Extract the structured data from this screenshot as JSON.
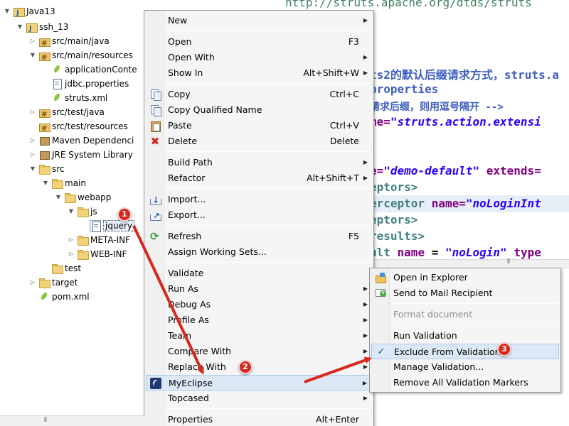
{
  "tree": {
    "items": [
      {
        "label": "Java13",
        "icon": "project-icon",
        "toggle": "▼"
      },
      {
        "label": "ssh_13",
        "icon": "maven-project-icon",
        "toggle": "▼"
      },
      {
        "label": "src/main/java",
        "icon": "source-folder-icon",
        "toggle": "▷"
      },
      {
        "label": "src/main/resources",
        "icon": "source-folder-icon",
        "toggle": "▼"
      },
      {
        "label": "applicationConte",
        "icon": "spring-leaf-icon",
        "toggle": ""
      },
      {
        "label": "jdbc.properties",
        "icon": "properties-file-icon",
        "toggle": ""
      },
      {
        "label": "struts.xml",
        "icon": "spring-leaf-icon",
        "toggle": ""
      },
      {
        "label": "src/test/java",
        "icon": "source-folder-icon",
        "toggle": "▷"
      },
      {
        "label": "src/test/resources",
        "icon": "source-folder-icon",
        "toggle": ""
      },
      {
        "label": "Maven Dependenci",
        "icon": "library-icon",
        "toggle": "▷"
      },
      {
        "label": "JRE System Library",
        "icon": "library-icon",
        "toggle": "▷"
      },
      {
        "label": "src",
        "icon": "folder-icon",
        "toggle": "▼"
      },
      {
        "label": "main",
        "icon": "folder-icon",
        "toggle": "▼"
      },
      {
        "label": "webapp",
        "icon": "folder-icon",
        "toggle": "▼"
      },
      {
        "label": "js",
        "icon": "folder-icon",
        "toggle": "▼"
      },
      {
        "label": "jquery",
        "icon": "js-file-icon",
        "toggle": ""
      },
      {
        "label": "META-INF",
        "icon": "folder-icon",
        "toggle": "▷"
      },
      {
        "label": "WEB-INF",
        "icon": "folder-icon",
        "toggle": "▷"
      },
      {
        "label": "test",
        "icon": "folder-icon",
        "toggle": ""
      },
      {
        "label": "target",
        "icon": "folder-icon",
        "toggle": "▷"
      },
      {
        "label": "pom.xml",
        "icon": "spring-leaf-icon",
        "toggle": ""
      }
    ]
  },
  "editor": {
    "lines": [
      {
        "parts": [
          {
            "t": "http://struts.apache.org/dtds/struts",
            "c": "c-url"
          }
        ]
      },
      {
        "parts": [
          {
            "t": "ts2的默认后缀请求方式，struts.a",
            "c": "c-comment"
          }
        ]
      },
      {
        "parts": [
          {
            "t": "properties",
            "c": "c-comment"
          }
        ]
      },
      {
        "parts": [
          {
            "t": "请求后缀，则用逗号隔开 -->",
            "c": "c-comment"
          }
        ]
      },
      {
        "parts": [
          {
            "t": "me=",
            "c": "c-attr"
          },
          {
            "t": "\"struts.action.extensi",
            "c": "c-val"
          }
        ]
      },
      {
        "parts": [
          {
            "t": "e=",
            "c": "c-attr"
          },
          {
            "t": "\"demo-default\"",
            "c": "c-val"
          },
          {
            "t": " extends=",
            "c": "c-attr"
          }
        ]
      },
      {
        "parts": [
          {
            "t": "eptors>",
            "c": "c-tag"
          }
        ]
      },
      {
        "parts": [
          {
            "t": "erceptor",
            "c": "c-tag"
          },
          {
            "t": " name=",
            "c": "c-attr"
          },
          {
            "t": "\"noLoginInt",
            "c": "c-val"
          }
        ]
      },
      {
        "parts": [
          {
            "t": "eptors>",
            "c": "c-tag"
          }
        ]
      },
      {
        "parts": [
          {
            "t": "results>",
            "c": "c-tag"
          }
        ]
      },
      {
        "parts": [
          {
            "t": "ult",
            "c": "c-tag"
          },
          {
            "t": " name",
            "c": "c-attr"
          },
          {
            "t": " = ",
            "c": "c-plain"
          },
          {
            "t": "\"noLogin\"",
            "c": "c-val"
          },
          {
            "t": " type",
            "c": "c-attr"
          }
        ]
      }
    ]
  },
  "context_menu": {
    "items": [
      {
        "label": "New",
        "shortcut": "",
        "arrow": "▶",
        "icon": ""
      },
      {
        "sep": true
      },
      {
        "label": "Open",
        "shortcut": "F3",
        "arrow": "",
        "icon": ""
      },
      {
        "label": "Open With",
        "shortcut": "",
        "arrow": "▶",
        "icon": ""
      },
      {
        "label": "Show In",
        "shortcut": "Alt+Shift+W",
        "arrow": "▶",
        "icon": ""
      },
      {
        "sep": true
      },
      {
        "label": "Copy",
        "shortcut": "Ctrl+C",
        "arrow": "",
        "icon": "copy-icon"
      },
      {
        "label": "Copy Qualified Name",
        "shortcut": "",
        "arrow": "",
        "icon": "copy-icon"
      },
      {
        "label": "Paste",
        "shortcut": "Ctrl+V",
        "arrow": "",
        "icon": "paste-icon"
      },
      {
        "label": "Delete",
        "shortcut": "Delete",
        "arrow": "",
        "icon": "delete-icon"
      },
      {
        "sep": true
      },
      {
        "label": "Build Path",
        "shortcut": "",
        "arrow": "▶",
        "icon": ""
      },
      {
        "label": "Refactor",
        "shortcut": "Alt+Shift+T",
        "arrow": "▶",
        "icon": ""
      },
      {
        "sep": true
      },
      {
        "label": "Import...",
        "shortcut": "",
        "arrow": "",
        "icon": "import-icon"
      },
      {
        "label": "Export...",
        "shortcut": "",
        "arrow": "",
        "icon": "export-icon"
      },
      {
        "sep": true
      },
      {
        "label": "Refresh",
        "shortcut": "F5",
        "arrow": "",
        "icon": "refresh-icon"
      },
      {
        "label": "Assign Working Sets...",
        "shortcut": "",
        "arrow": "",
        "icon": ""
      },
      {
        "sep": true
      },
      {
        "label": "Validate",
        "shortcut": "",
        "arrow": "",
        "icon": ""
      },
      {
        "label": "Run As",
        "shortcut": "",
        "arrow": "▶",
        "icon": ""
      },
      {
        "label": "Debug As",
        "shortcut": "",
        "arrow": "▶",
        "icon": ""
      },
      {
        "label": "Profile As",
        "shortcut": "",
        "arrow": "▶",
        "icon": ""
      },
      {
        "label": "Team",
        "shortcut": "",
        "arrow": "▶",
        "icon": ""
      },
      {
        "label": "Compare With",
        "shortcut": "",
        "arrow": "▶",
        "icon": ""
      },
      {
        "label": "Replace With",
        "shortcut": "",
        "arrow": "▶",
        "icon": ""
      },
      {
        "label": "MyEclipse",
        "shortcut": "",
        "arrow": "▶",
        "icon": "myeclipse-icon",
        "highlighted": true
      },
      {
        "label": "Topcased",
        "shortcut": "",
        "arrow": "▶",
        "icon": ""
      },
      {
        "sep": true
      },
      {
        "label": "Properties",
        "shortcut": "Alt+Enter",
        "arrow": "",
        "icon": ""
      }
    ]
  },
  "submenu": {
    "items": [
      {
        "label": "Open in Explorer",
        "icon": "explorer-icon"
      },
      {
        "label": "Send to Mail Recipient",
        "icon": "mail-icon"
      },
      {
        "sep": true
      },
      {
        "label": "Format document",
        "disabled": true
      },
      {
        "sep": true
      },
      {
        "label": "Run Validation"
      },
      {
        "label": "Exclude From Validation",
        "icon": "check-icon",
        "highlighted": true
      },
      {
        "label": "Manage Validation..."
      },
      {
        "label": "Remove All Validation Markers"
      }
    ]
  },
  "badges": [
    "1",
    "2",
    "3"
  ],
  "colors": {
    "annotation_red": "#d8281e",
    "menu_highlight": "#dde8f7",
    "menu_background": "#f5f5f5"
  }
}
